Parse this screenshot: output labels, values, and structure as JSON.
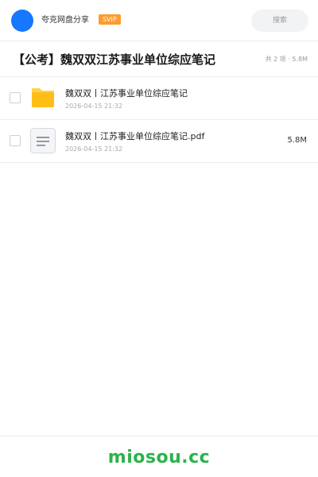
{
  "header": {
    "username": "夸克网盘分享",
    "badge": "SVIP",
    "search_label": "搜索",
    "colors": {
      "avatar": "#1677ff",
      "badge": "#ff9a2e"
    }
  },
  "share": {
    "title": "【公考】魏双双江苏事业单位综应笔记",
    "meta": "共 2 项 · 5.8M"
  },
  "files": [
    {
      "name": "魏双双丨江苏事业单位综应笔记",
      "date": "2026-04-15 21:32",
      "size": "",
      "icon": "folder-icon"
    },
    {
      "name": "魏双双丨江苏事业单位综应笔记.pdf",
      "date": "2026-04-15 21:32",
      "size": "5.8M",
      "icon": "document-icon"
    }
  ],
  "footer": {
    "watermark": "miosou.cc",
    "color": "#2bb34a"
  }
}
